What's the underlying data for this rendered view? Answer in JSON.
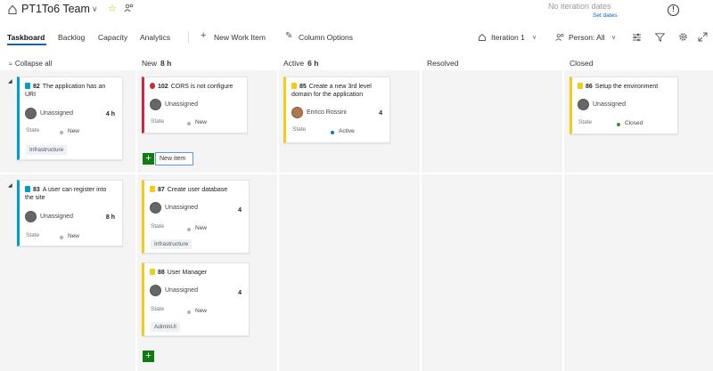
{
  "header": {
    "team_name": "PT1To6 Team",
    "iteration_dates": "No iteration dates",
    "set_dates": "Set dates"
  },
  "toolbar": {
    "tabs": [
      {
        "label": "Taskboard",
        "active": true
      },
      {
        "label": "Backlog"
      },
      {
        "label": "Capacity"
      },
      {
        "label": "Analytics"
      }
    ],
    "new_work_item": "New Work Item",
    "column_options": "Column Options",
    "iteration": "Iteration 1",
    "person": "Person: All"
  },
  "board": {
    "collapse_all": "Collapse all",
    "columns": [
      {
        "name": "New",
        "hours": "8 h"
      },
      {
        "name": "Active",
        "hours": "6 h"
      },
      {
        "name": "Resolved",
        "hours": ""
      },
      {
        "name": "Closed",
        "hours": ""
      }
    ],
    "lanes": [
      {
        "id": "82",
        "title": "The application has an URI",
        "assignee": "Unassigned",
        "remaining": "4 h",
        "state_label": "State",
        "state": "New",
        "tag": "Infrastructure"
      },
      {
        "id": "83",
        "title": "A user can register into the site",
        "assignee": "Unassigned",
        "remaining": "8 h",
        "state_label": "State",
        "state": "New"
      }
    ],
    "tasks": {
      "t102": {
        "id": "102",
        "title": "CORS is not configure",
        "assignee": "Unassigned",
        "state_label": "State",
        "state": "New"
      },
      "t85": {
        "id": "85",
        "title": "Create a new 3rd level domain for the application",
        "assignee": "Enrico Rossini",
        "remaining": "4",
        "state_label": "State",
        "state": "Active"
      },
      "t86": {
        "id": "86",
        "title": "Setup the environment",
        "assignee": "Unassigned",
        "state_label": "State",
        "state": "Closed"
      },
      "t87": {
        "id": "87",
        "title": "Create user database",
        "assignee": "Unassigned",
        "remaining": "4",
        "state_label": "State",
        "state": "New",
        "tag": "Infrastructure"
      },
      "t88": {
        "id": "88",
        "title": "User Manager",
        "assignee": "Unassigned",
        "remaining": "4",
        "state_label": "State",
        "state": "New",
        "tag": "AdminUI"
      }
    },
    "new_item": "New item"
  },
  "icons": {
    "team": "taskboard-icon",
    "favorite": "star-icon",
    "members": "people-icon",
    "info": "info-icon",
    "filter": "filter-icon",
    "settings": "gear-icon",
    "expand": "expand-icon"
  },
  "colors": {
    "accent": "#0a66c2",
    "story": "#009ccc",
    "task": "#f2cb1d",
    "bug": "#cc293d",
    "add": "#107c10",
    "state_active": "#007acc",
    "state_closed": "#339933"
  }
}
